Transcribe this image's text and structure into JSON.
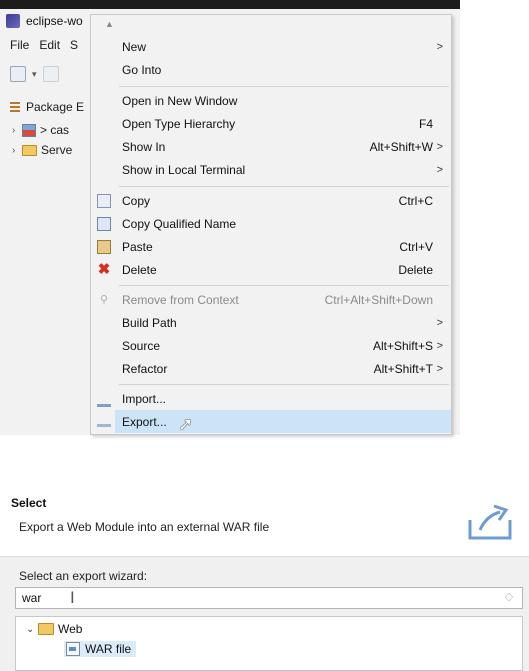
{
  "eclipse": {
    "title": "eclipse-wo",
    "menubar": [
      "File",
      "Edit",
      "S"
    ],
    "package_explorer_label": "Package E",
    "tree": [
      {
        "label": "> cas",
        "icon": "project-icon"
      },
      {
        "label": "Serve",
        "icon": "folder-icon"
      }
    ]
  },
  "context_menu": {
    "items": [
      {
        "label": "New",
        "accel": "",
        "submenu": true
      },
      {
        "label": "Go Into",
        "accel": ""
      },
      {
        "label": "Open in New Window",
        "accel": ""
      },
      {
        "label": "Open Type Hierarchy",
        "accel": "F4"
      },
      {
        "label": "Show In",
        "accel": "Alt+Shift+W",
        "submenu": true
      },
      {
        "label": "Show in Local Terminal",
        "accel": "",
        "submenu": true
      },
      {
        "label": "Copy",
        "accel": "Ctrl+C",
        "icon": "copy-icon"
      },
      {
        "label": "Copy Qualified Name",
        "accel": "",
        "icon": "copy-qualified-name-icon"
      },
      {
        "label": "Paste",
        "accel": "Ctrl+V",
        "icon": "paste-icon"
      },
      {
        "label": "Delete",
        "accel": "Delete",
        "icon": "delete-icon"
      },
      {
        "label": "Remove from Context",
        "accel": "Ctrl+Alt+Shift+Down",
        "disabled": true,
        "icon": "remove-from-context-icon"
      },
      {
        "label": "Build Path",
        "accel": "",
        "submenu": true
      },
      {
        "label": "Source",
        "accel": "Alt+Shift+S",
        "submenu": true
      },
      {
        "label": "Refactor",
        "accel": "Alt+Shift+T",
        "submenu": true
      },
      {
        "label": "Import...",
        "accel": "",
        "icon": "import-icon"
      },
      {
        "label": "Export...",
        "accel": "",
        "icon": "export-icon",
        "highlighted": true
      }
    ],
    "submenu_glyph": ">"
  },
  "wizard": {
    "title": "Select",
    "description": "Export a Web Module into an external WAR file",
    "filter_label": "Select an export wizard:",
    "filter_value": "war",
    "tree": {
      "folder_label": "Web",
      "item_label": "WAR file"
    }
  },
  "colors": {
    "highlight": "#cce4f7",
    "menu_bg": "#f2f2f2",
    "wizard_body_bg": "#f0f0f0",
    "selection": "#dcebfa"
  }
}
